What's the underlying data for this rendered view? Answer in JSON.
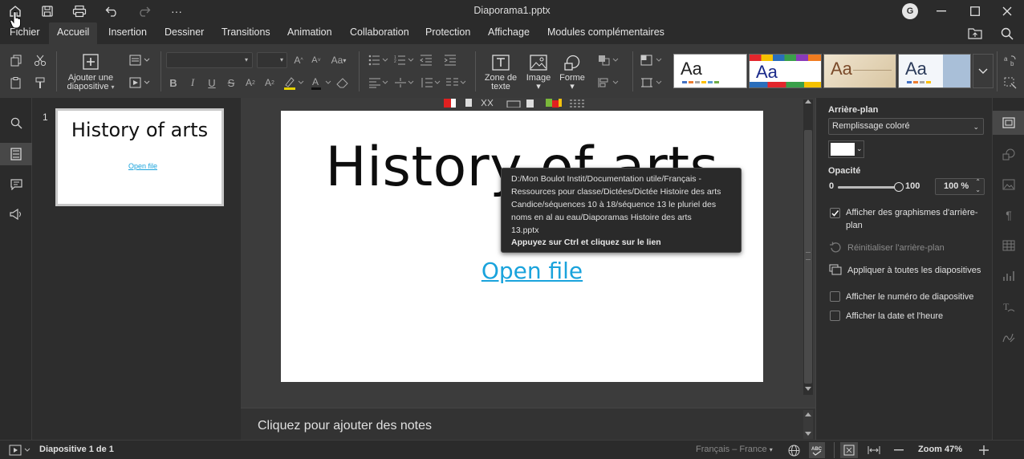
{
  "window": {
    "title": "Diaporama1.pptx",
    "user_initial": "G"
  },
  "menu": {
    "tabs": [
      "Fichier",
      "Accueil",
      "Insertion",
      "Dessiner",
      "Transitions",
      "Animation",
      "Collaboration",
      "Protection",
      "Affichage",
      "Modules complémentaires"
    ],
    "active": "Accueil"
  },
  "ribbon": {
    "add_slide_line1": "Ajouter une",
    "add_slide_line2": "diapositive",
    "textbox_line1": "Zone de",
    "textbox_line2": "texte",
    "image_label": "Image",
    "shape_label": "Forme",
    "theme_sample": "Aa"
  },
  "thumbnails": [
    {
      "number": "1",
      "title": "History of arts",
      "link": "Open file"
    }
  ],
  "slide": {
    "title": "History of arts",
    "link": "Open file"
  },
  "tooltip": {
    "path_lines": [
      "D:/Mon Boulot Instit/Documentation utile/Français -",
      "Ressources pour classe/Dictées/Dictée Histoire des arts",
      "Candice/séquences 10 à 18/séquence 13 le pluriel des",
      "noms en al au eau/Diaporamas Histoire des arts",
      "13.pptx"
    ],
    "hint": "Appuyez sur Ctrl et cliquez sur le lien"
  },
  "notes": {
    "placeholder": "Cliquez pour ajouter des notes"
  },
  "background_panel": {
    "heading": "Arrière-plan",
    "fill_value": "Remplissage coloré",
    "opacity_label": "Opacité",
    "opacity_min": "0",
    "opacity_max": "100",
    "opacity_value": "100 %",
    "opacity_level": 1.0,
    "show_graphics_line1": "Afficher des graphismes d'arrière-",
    "show_graphics_line2": "plan",
    "reset_label": "Réinitialiser l'arrière-plan",
    "apply_all_label": "Appliquer à toutes les diapositives",
    "show_slide_number": "Afficher le numéro de diapositive",
    "show_date": "Afficher la date et l'heure"
  },
  "status": {
    "slide_info": "Diapositive 1 de 1",
    "language": "Français – France",
    "zoom": "Zoom 47%"
  },
  "colors": {
    "accent": "#2ea3df",
    "link": "#1aa3dc"
  }
}
